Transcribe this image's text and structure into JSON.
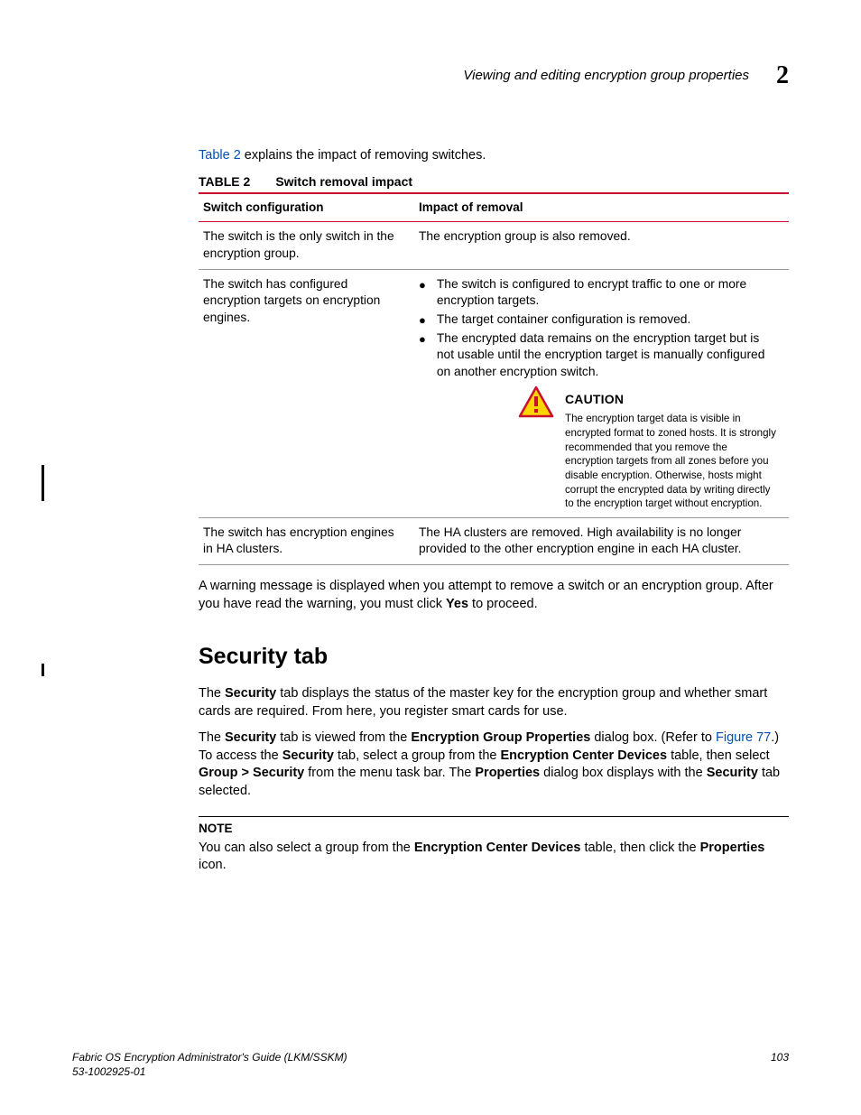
{
  "header": {
    "running_title": "Viewing and editing encryption group properties",
    "chapter_number": "2"
  },
  "intro": {
    "prefix": "Table 2",
    "rest": " explains the impact of removing switches."
  },
  "table": {
    "label": "TABLE 2",
    "title": "Switch removal impact",
    "head_col1": "Switch configuration",
    "head_col2": "Impact of removal",
    "rows": [
      {
        "config": "The switch is the only switch in the encryption group.",
        "impact_text": "The encryption group is also removed."
      },
      {
        "config": "The switch has configured encryption targets on encryption engines.",
        "bullets": [
          "The switch is configured to encrypt traffic to one or more encryption targets.",
          "The target container configuration is removed.",
          "The encrypted data remains on the encryption target but is not usable until the encryption target is manually configured on another encryption switch."
        ],
        "caution_head": "CAUTION",
        "caution_body": "The encryption target data is visible in encrypted format to zoned hosts. It is strongly recommended that you remove the encryption targets from all zones before you disable encryption. Otherwise, hosts might corrupt the encrypted data by writing directly to the encryption target without encryption."
      },
      {
        "config": "The switch has encryption engines in HA clusters.",
        "impact_text": "The HA clusters are removed. High availability is no longer provided to the other encryption engine in each HA cluster."
      }
    ]
  },
  "para_after_table": {
    "t1": "A warning message is displayed when you attempt to remove a switch or an encryption group. After you have read the warning, you must click ",
    "b1": "Yes",
    "t2": " to proceed."
  },
  "section_heading": "Security tab",
  "para_sec1": {
    "t1": "The ",
    "b1": "Security",
    "t2": " tab displays the status of the master key for the encryption group and whether smart cards are required. From here, you register smart cards for use."
  },
  "para_sec2": {
    "t1": "The ",
    "b1": "Security",
    "t2": " tab is viewed from the ",
    "b2": "Encryption Group Properties",
    "t3": " dialog box. (Refer to ",
    "link": "Figure 77",
    "t4": ".) To access the ",
    "b3": "Security",
    "t5": " tab, select a group from the ",
    "b4": "Encryption Center Devices",
    "t6": " table, then select ",
    "b5": "Group > Security",
    "t7": " from the menu task bar. The ",
    "b6": "Properties",
    "t8": " dialog box displays with the ",
    "b7": "Security",
    "t9": " tab selected."
  },
  "note": {
    "head": "NOTE",
    "t1": "You can also select a group from the ",
    "b1": "Encryption Center Devices",
    "t2": " table, then click the ",
    "b2": "Properties",
    "t3": " icon."
  },
  "footer": {
    "title": "Fabric OS Encryption Administrator's Guide  (LKM/SSKM)",
    "docnum": "53-1002925-01",
    "page": "103"
  },
  "chart_data": {
    "type": "table",
    "title": "Switch removal impact",
    "columns": [
      "Switch configuration",
      "Impact of removal"
    ],
    "rows": [
      [
        "The switch is the only switch in the encryption group.",
        "The encryption group is also removed."
      ],
      [
        "The switch has configured encryption targets on encryption engines.",
        "• The switch is configured to encrypt traffic to one or more encryption targets. • The target container configuration is removed. • The encrypted data remains on the encryption target but is not usable until the encryption target is manually configured on another encryption switch. CAUTION: The encryption target data is visible in encrypted format to zoned hosts. It is strongly recommended that you remove the encryption targets from all zones before you disable encryption. Otherwise, hosts might corrupt the encrypted data by writing directly to the encryption target without encryption."
      ],
      [
        "The switch has encryption engines in HA clusters.",
        "The HA clusters are removed. High availability is no longer provided to the other encryption engine in each HA cluster."
      ]
    ]
  }
}
